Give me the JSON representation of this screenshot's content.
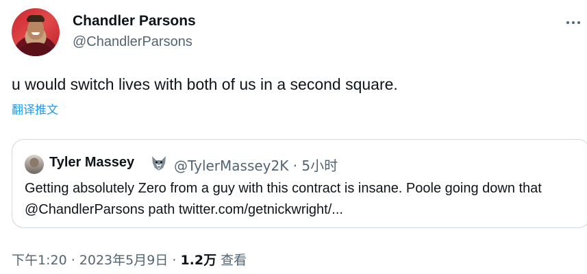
{
  "author": {
    "name": "Chandler Parsons",
    "handle": "@ChandlerParsons"
  },
  "tweet": {
    "text": "u would switch lives with both of us in a second square.",
    "translate_label": "翻译推文"
  },
  "quote": {
    "name": "Tyler Massey",
    "badge_icon": "wolf-icon",
    "handle_time": "@TylerMassey2K · 5小时",
    "text": "Getting absolutely Zero from a guy with this contract is insane. Poole going down that @ChandlerParsons path twitter.com/getnickwright/..."
  },
  "meta": {
    "time_date": "下午1:20 · 2023年5月9日 · ",
    "views_count": "1.2万",
    "views_label": " 查看"
  },
  "colors": {
    "link": "#1d9bf0",
    "secondary_text": "#536471",
    "border": "#cfd9de"
  }
}
